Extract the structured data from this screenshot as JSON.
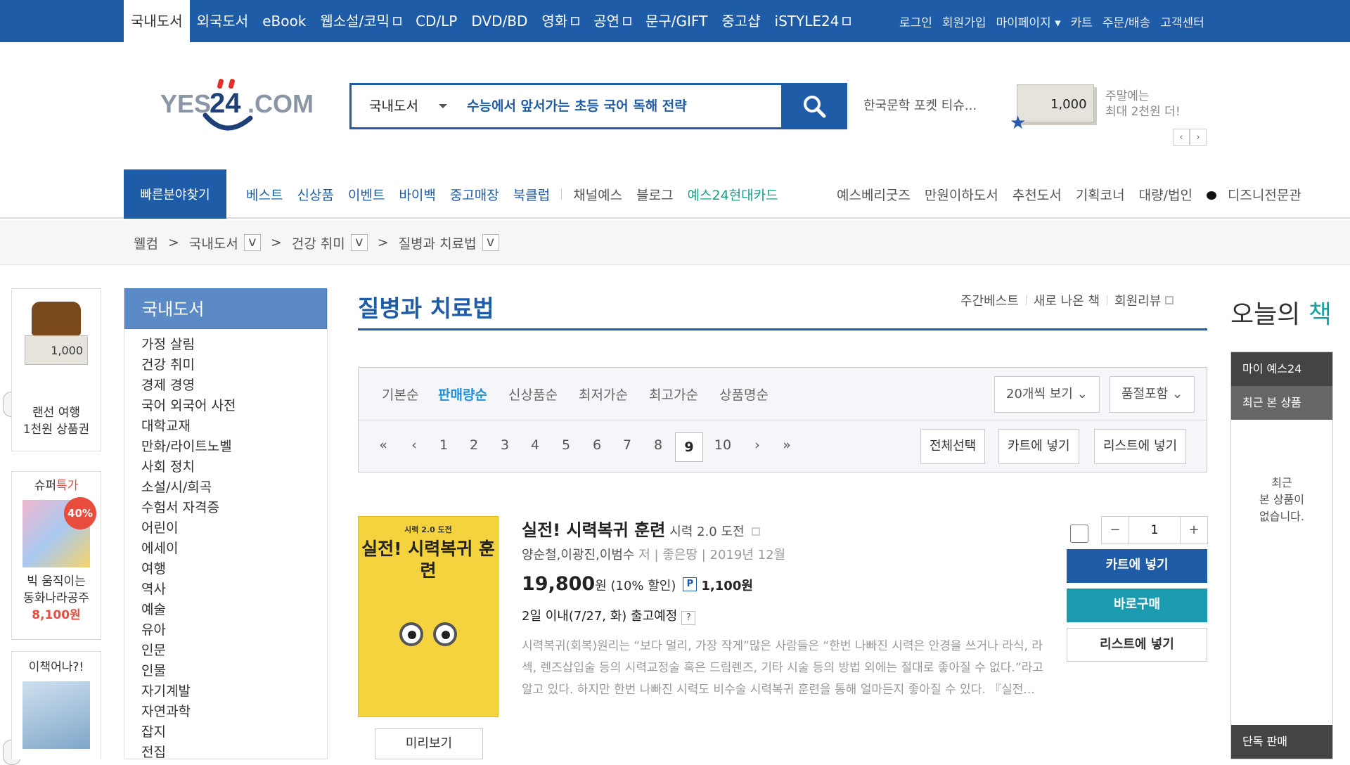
{
  "topnav": {
    "items": [
      {
        "label": "국내도서"
      },
      {
        "label": "외국도서"
      },
      {
        "label": "eBook"
      },
      {
        "label": "웹소설/코믹"
      },
      {
        "label": "CD/LP"
      },
      {
        "label": "DVD/BD"
      },
      {
        "label": "영화"
      },
      {
        "label": "공연"
      },
      {
        "label": "문구/GIFT"
      },
      {
        "label": "중고샵"
      },
      {
        "label": "iSTYLE24"
      }
    ],
    "util": [
      "로그인",
      "회원가입",
      "마이페이지",
      "카트",
      "주문/배송",
      "고객센터"
    ]
  },
  "logo": {
    "text": "YES24.COM"
  },
  "search": {
    "category": "국내도서",
    "query": "수능에서 앞서가는 초등 국어 독해 전략"
  },
  "hot_keyword": "한국문학 포켓 티슈...",
  "banner": {
    "amount": "1,000",
    "line1": "주말에는",
    "line2": "최대 2천원 더!"
  },
  "gnb": {
    "quick": "빠른분야찾기",
    "left": [
      "베스트",
      "신상품",
      "이벤트",
      "바이백",
      "중고매장",
      "북클럽",
      "채널예스",
      "블로그",
      "예스24현대카드"
    ],
    "right": [
      "예스베리굿즈",
      "만원이하도서",
      "추천도서",
      "기획코너",
      "대량/법인",
      "디즈니전문관"
    ]
  },
  "breadcrumb": [
    "웰컴",
    "국내도서",
    "건강 취미",
    "질병과 치료법"
  ],
  "left_banners": {
    "b1": {
      "amount": "1,000",
      "line1": "랜선 여행",
      "line2": "1천원 상품권"
    },
    "b2": {
      "head_a": "슈퍼",
      "head_b": "특가",
      "sale": "40%",
      "line1": "빅 움직이는",
      "line2": "동화나라공주",
      "price": "8,100원"
    },
    "b3": {
      "head": "이책어나?!"
    }
  },
  "sidebar": {
    "title": "국내도서",
    "items": [
      "가정 살림",
      "건강 취미",
      "경제 경영",
      "국어 외국어 사전",
      "대학교재",
      "만화/라이트노벨",
      "사회 정치",
      "소설/시/희곡",
      "수험서 자격증",
      "어린이",
      "에세이",
      "여행",
      "역사",
      "예술",
      "유아",
      "인문",
      "인물",
      "자기계발",
      "자연과학",
      "잡지",
      "전집"
    ]
  },
  "main": {
    "title": "질병과 치료법",
    "links": [
      "주간베스트",
      "새로 나온 책",
      "회원리뷰"
    ],
    "sort": [
      "기본순",
      "판매량순",
      "신상품순",
      "최저가순",
      "최고가순",
      "상품명순"
    ],
    "sort_active": 1,
    "per_page": "20개씩 보기",
    "stock": "품절포함",
    "pages": [
      "1",
      "2",
      "3",
      "4",
      "5",
      "6",
      "7",
      "8",
      "9",
      "10"
    ],
    "current_page": "9",
    "actions": [
      "전체선택",
      "카트에 넣기",
      "리스트에 넣기"
    ]
  },
  "product": {
    "cover_top": "시력 2.0 도전",
    "cover_title": "실전! 시력복귀 훈련",
    "title": "실전! 시력복귀 훈련",
    "subtitle": "시력 2.0 도전",
    "authors": "양순철,이광진,이범수",
    "author_role": "저",
    "publisher": "좋은땅",
    "date": "2019년 12월",
    "price": "19,800",
    "price_unit": "원",
    "discount": "(10% 할인)",
    "point_label": "P",
    "points": "1,100원",
    "shipping": "2일 이내(7/27, 화) 출고예정",
    "shipping_help": "?",
    "description": "시력복귀(회복)원리는 “보다 멀리, 가장 작게”많은 사람들은 “한번 나빠진 시력은 안경을 쓰거나 라식, 라섹, 렌즈삽입술 등의 시력교정술 혹은 드림렌즈, 기타 시술 등의 방법 외에는 절대로 좋아질 수 없다.”라고 알고 있다. 하지만 한번 나빠진 시력도 비수술 시력복귀 훈련을 통해 얼마든지 좋아질 수 있다. 『실전...",
    "preview": "미리보기",
    "qty": "1",
    "btn_cart": "카트에 넣기",
    "btn_buy": "바로구매",
    "btn_list": "리스트에 넣기"
  },
  "right": {
    "today_a": "오늘의",
    "today_b": "책",
    "my": "마이 예스24",
    "recent": "최근 본 상품",
    "empty1": "최근",
    "empty2": "본 상품이",
    "empty3": "없습니다.",
    "bottom": "단독 판매"
  },
  "colors": {
    "brand": "#1f5ca8",
    "teal": "#16a0a0",
    "sale": "#e74c3c"
  }
}
